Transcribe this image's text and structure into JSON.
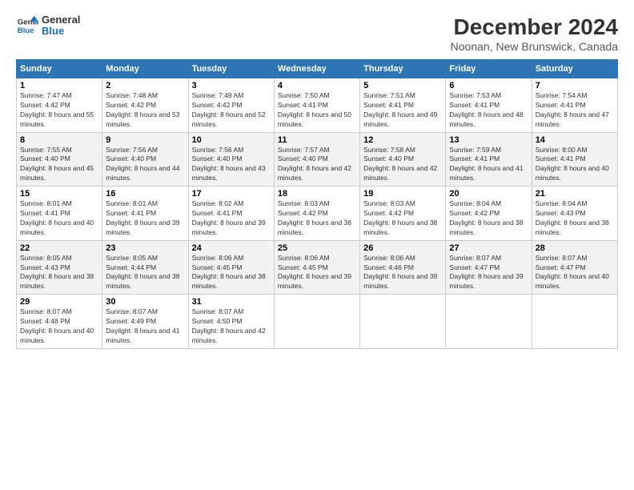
{
  "logo": {
    "line1": "General",
    "line2": "Blue"
  },
  "title": "December 2024",
  "subtitle": "Noonan, New Brunswick, Canada",
  "days_of_week": [
    "Sunday",
    "Monday",
    "Tuesday",
    "Wednesday",
    "Thursday",
    "Friday",
    "Saturday"
  ],
  "weeks": [
    [
      {
        "day": "1",
        "sunrise": "7:47 AM",
        "sunset": "4:42 PM",
        "daylight": "8 hours and 55 minutes."
      },
      {
        "day": "2",
        "sunrise": "7:48 AM",
        "sunset": "4:42 PM",
        "daylight": "8 hours and 53 minutes."
      },
      {
        "day": "3",
        "sunrise": "7:49 AM",
        "sunset": "4:42 PM",
        "daylight": "8 hours and 52 minutes."
      },
      {
        "day": "4",
        "sunrise": "7:50 AM",
        "sunset": "4:41 PM",
        "daylight": "8 hours and 50 minutes."
      },
      {
        "day": "5",
        "sunrise": "7:51 AM",
        "sunset": "4:41 PM",
        "daylight": "8 hours and 49 minutes."
      },
      {
        "day": "6",
        "sunrise": "7:53 AM",
        "sunset": "4:41 PM",
        "daylight": "8 hours and 48 minutes."
      },
      {
        "day": "7",
        "sunrise": "7:54 AM",
        "sunset": "4:41 PM",
        "daylight": "8 hours and 47 minutes."
      }
    ],
    [
      {
        "day": "8",
        "sunrise": "7:55 AM",
        "sunset": "4:40 PM",
        "daylight": "8 hours and 45 minutes."
      },
      {
        "day": "9",
        "sunrise": "7:56 AM",
        "sunset": "4:40 PM",
        "daylight": "8 hours and 44 minutes."
      },
      {
        "day": "10",
        "sunrise": "7:56 AM",
        "sunset": "4:40 PM",
        "daylight": "8 hours and 43 minutes."
      },
      {
        "day": "11",
        "sunrise": "7:57 AM",
        "sunset": "4:40 PM",
        "daylight": "8 hours and 42 minutes."
      },
      {
        "day": "12",
        "sunrise": "7:58 AM",
        "sunset": "4:40 PM",
        "daylight": "8 hours and 42 minutes."
      },
      {
        "day": "13",
        "sunrise": "7:59 AM",
        "sunset": "4:41 PM",
        "daylight": "8 hours and 41 minutes."
      },
      {
        "day": "14",
        "sunrise": "8:00 AM",
        "sunset": "4:41 PM",
        "daylight": "8 hours and 40 minutes."
      }
    ],
    [
      {
        "day": "15",
        "sunrise": "8:01 AM",
        "sunset": "4:41 PM",
        "daylight": "8 hours and 40 minutes."
      },
      {
        "day": "16",
        "sunrise": "8:01 AM",
        "sunset": "4:41 PM",
        "daylight": "8 hours and 39 minutes."
      },
      {
        "day": "17",
        "sunrise": "8:02 AM",
        "sunset": "4:41 PM",
        "daylight": "8 hours and 39 minutes."
      },
      {
        "day": "18",
        "sunrise": "8:03 AM",
        "sunset": "4:42 PM",
        "daylight": "8 hours and 38 minutes."
      },
      {
        "day": "19",
        "sunrise": "8:03 AM",
        "sunset": "4:42 PM",
        "daylight": "8 hours and 38 minutes."
      },
      {
        "day": "20",
        "sunrise": "8:04 AM",
        "sunset": "4:42 PM",
        "daylight": "8 hours and 38 minutes."
      },
      {
        "day": "21",
        "sunrise": "8:04 AM",
        "sunset": "4:43 PM",
        "daylight": "8 hours and 38 minutes."
      }
    ],
    [
      {
        "day": "22",
        "sunrise": "8:05 AM",
        "sunset": "4:43 PM",
        "daylight": "8 hours and 38 minutes."
      },
      {
        "day": "23",
        "sunrise": "8:05 AM",
        "sunset": "4:44 PM",
        "daylight": "8 hours and 38 minutes."
      },
      {
        "day": "24",
        "sunrise": "8:06 AM",
        "sunset": "4:45 PM",
        "daylight": "8 hours and 38 minutes."
      },
      {
        "day": "25",
        "sunrise": "8:06 AM",
        "sunset": "4:45 PM",
        "daylight": "8 hours and 39 minutes."
      },
      {
        "day": "26",
        "sunrise": "8:06 AM",
        "sunset": "4:46 PM",
        "daylight": "8 hours and 39 minutes."
      },
      {
        "day": "27",
        "sunrise": "8:07 AM",
        "sunset": "4:47 PM",
        "daylight": "8 hours and 39 minutes."
      },
      {
        "day": "28",
        "sunrise": "8:07 AM",
        "sunset": "4:47 PM",
        "daylight": "8 hours and 40 minutes."
      }
    ],
    [
      {
        "day": "29",
        "sunrise": "8:07 AM",
        "sunset": "4:48 PM",
        "daylight": "8 hours and 40 minutes."
      },
      {
        "day": "30",
        "sunrise": "8:07 AM",
        "sunset": "4:49 PM",
        "daylight": "8 hours and 41 minutes."
      },
      {
        "day": "31",
        "sunrise": "8:07 AM",
        "sunset": "4:50 PM",
        "daylight": "8 hours and 42 minutes."
      },
      null,
      null,
      null,
      null
    ]
  ]
}
